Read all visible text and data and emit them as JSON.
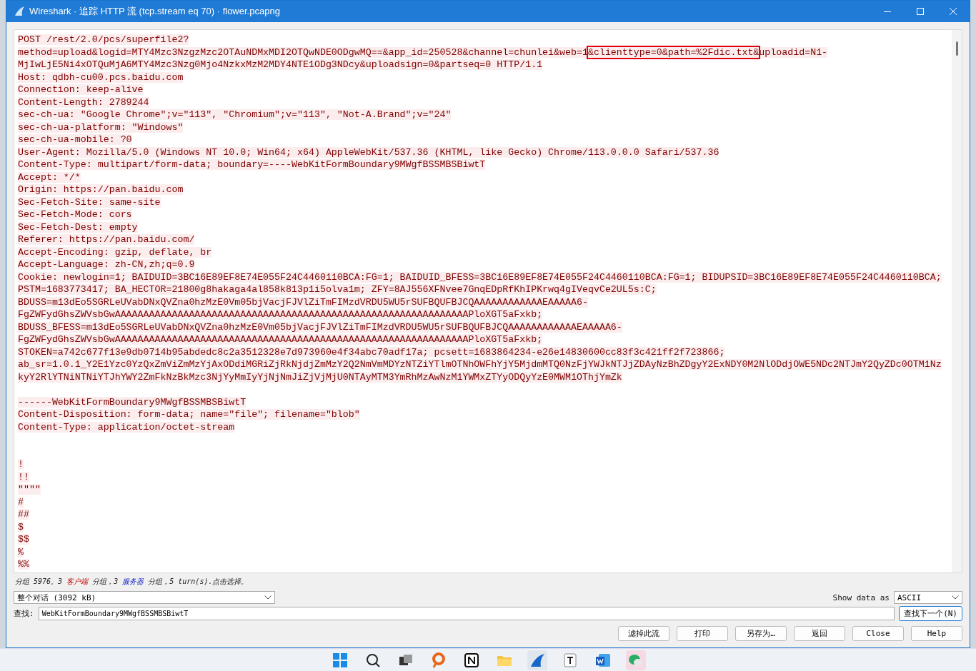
{
  "window": {
    "title": "Wireshark · 追踪 HTTP 流 (tcp.stream eq 70) · flower.pcapng"
  },
  "stream": {
    "lines": [
      {
        "kind": "text",
        "text": "POST /rest/2.0/pcs/superfile2?"
      },
      {
        "kind": "marked",
        "before": "method=upload&logid=MTY4Mzc3NzgzMzc2OTAuNDMxMDI2OTQwNDE0ODgwMQ==&app_id=250528&channel=chunlei&web=1",
        "boxed": "&clienttype=0&path=%2Fdic.txt&",
        "after": "uploadid=N1-"
      },
      {
        "kind": "text",
        "text": "MjIwLjE5Ni4xOTQuMjA6MTY4Mzc3Nzg0Mjo4NzkxMzM2MDY4NTE1ODg3NDcy&uploadsign=0&partseq=0 HTTP/1.1"
      },
      {
        "kind": "text",
        "text": "Host: qdbh-cu00.pcs.baidu.com"
      },
      {
        "kind": "text",
        "text": "Connection: keep-alive"
      },
      {
        "kind": "text",
        "text": "Content-Length: 2789244"
      },
      {
        "kind": "text",
        "text": "sec-ch-ua: \"Google Chrome\";v=\"113\", \"Chromium\";v=\"113\", \"Not-A.Brand\";v=\"24\""
      },
      {
        "kind": "text",
        "text": "sec-ch-ua-platform: \"Windows\""
      },
      {
        "kind": "text",
        "text": "sec-ch-ua-mobile: ?0"
      },
      {
        "kind": "text",
        "text": "User-Agent: Mozilla/5.0 (Windows NT 10.0; Win64; x64) AppleWebKit/537.36 (KHTML, like Gecko) Chrome/113.0.0.0 Safari/537.36"
      },
      {
        "kind": "text",
        "text": "Content-Type: multipart/form-data; boundary=----WebKitFormBoundary9MWgfBSSMBSBiwtT"
      },
      {
        "kind": "text",
        "text": "Accept: */*"
      },
      {
        "kind": "text",
        "text": "Origin: https://pan.baidu.com"
      },
      {
        "kind": "text",
        "text": "Sec-Fetch-Site: same-site"
      },
      {
        "kind": "text",
        "text": "Sec-Fetch-Mode: cors"
      },
      {
        "kind": "text",
        "text": "Sec-Fetch-Dest: empty"
      },
      {
        "kind": "text",
        "text": "Referer: https://pan.baidu.com/"
      },
      {
        "kind": "text",
        "text": "Accept-Encoding: gzip, deflate, br"
      },
      {
        "kind": "text",
        "text": "Accept-Language: zh-CN,zh;q=0.9"
      },
      {
        "kind": "text",
        "text": "Cookie: newlogin=1; BAIDUID=3BC16E89EF8E74E055F24C4460110BCA:FG=1; BAIDUID_BFESS=3BC16E89EF8E74E055F24C4460110BCA:FG=1; BIDUPSID=3BC16E89EF8E74E055F24C4460110BCA;"
      },
      {
        "kind": "text",
        "text": "PSTM=1683773417; BA_HECTOR=21800g8hakaga4al858k813p1i5olva1m; ZFY=8AJ556XFNvee7GnqEDpRfKhIPKrwq4gIVeqvCe2UL5s:C;"
      },
      {
        "kind": "text",
        "text": "BDUSS=m13dEo5SGRLeUVabDNxQVZna0hzMzE0Vm05bjVacjFJVlZiTmFIMzdVRDU5WU5rSUFBQUFBJCQAAAAAAAAAAAAEAAAAA6-"
      },
      {
        "kind": "text",
        "text": "FgZWFydGhsZWVsbGwAAAAAAAAAAAAAAAAAAAAAAAAAAAAAAAAAAAAAAAAAAAAAAAAAAAAAAAAAAAAAAPloXGT5aFxkb;"
      },
      {
        "kind": "text",
        "text": "BDUSS_BFESS=m13dEo5SGRLeUVabDNxQVZna0hzMzE0Vm05bjVacjFJVlZiTmFIMzdVRDU5WU5rSUFBQUFBJCQAAAAAAAAAAAAEAAAAA6-"
      },
      {
        "kind": "text",
        "text": "FgZWFydGhsZWVsbGwAAAAAAAAAAAAAAAAAAAAAAAAAAAAAAAAAAAAAAAAAAAAAAAAAAAAAAAAAAAAAAPloXGT5aFxkb;"
      },
      {
        "kind": "text",
        "text": "STOKEN=a742c677f13e9db0714b95abdedc8c2a3512328e7d973960e4f34abc70adf17a; pcsett=1683864234-e26e14830600cc83f3c421ff2f723866;"
      },
      {
        "kind": "text",
        "text": "ab_sr=1.0.1_Y2E1Yzc0YzQxZmViZmMzYjAxODdiMGRiZjRkNjdjZmMzY2Q2NmVmMDYzNTZiYTlmOTNhOWFhYjY5MjdmMTQ0NzFjYWJkNTJjZDAyNzBhZDgyY2ExNDY0M2NlODdjOWE5NDc2NTJmY2QyZDc0OTM1Nz"
      },
      {
        "kind": "text",
        "text": "kyY2RlYTNiNTNiYTJhYWY2ZmFkNzBkMzc3NjYyMmIyYjNjNmJiZjVjMjU0NTAyMTM3YmRhMzAwNzM1YWMxZTYyODQyYzE0MWM1OThjYmZk"
      },
      {
        "kind": "blank"
      },
      {
        "kind": "text",
        "text": "------WebKitFormBoundary9MWgfBSSMBSBiwtT"
      },
      {
        "kind": "text",
        "text": "Content-Disposition: form-data; name=\"file\"; filename=\"blob\""
      },
      {
        "kind": "text",
        "text": "Content-Type: application/octet-stream"
      },
      {
        "kind": "blank"
      },
      {
        "kind": "blank"
      },
      {
        "kind": "text",
        "text": "!"
      },
      {
        "kind": "text",
        "text": "!!"
      },
      {
        "kind": "text",
        "text": "\"\"\"\""
      },
      {
        "kind": "text",
        "text": "#"
      },
      {
        "kind": "text",
        "text": "##"
      },
      {
        "kind": "text",
        "text": "$"
      },
      {
        "kind": "text",
        "text": "$$"
      },
      {
        "kind": "text",
        "text": "%"
      },
      {
        "kind": "text",
        "text": "%%"
      }
    ]
  },
  "summary": {
    "before": "分组 5976。3 ",
    "client": "客户端",
    "middle": " 分组，3 ",
    "server": "服务器",
    "after": " 分组，5 turn(s).点击选择。"
  },
  "conversation_select": {
    "value": "整个对话 (3092 kB)"
  },
  "show_data_as": {
    "label": "Show data as",
    "value": "ASCII"
  },
  "find": {
    "label": "查找:",
    "value": "WebKitFormBoundary9MWgfBSSMBSBiwtT",
    "button": "查找下一个(N)"
  },
  "buttons": [
    "滤掉此流",
    "打印",
    "另存为…",
    "返回",
    "Close",
    "Help"
  ]
}
